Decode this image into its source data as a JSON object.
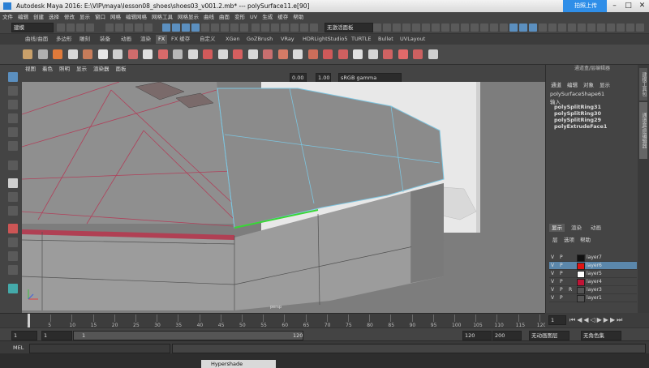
{
  "window": {
    "title": "Autodesk Maya 2016: E:\\VIP\\maya\\lesson08_shoes\\shoes03_v001.2.mb*  ---  polySurface11.e[90]",
    "upload_label": "拍照上传",
    "min": "–",
    "max": "□",
    "close": "✕"
  },
  "menus": [
    "文件",
    "编辑",
    "创建",
    "选择",
    "修改",
    "显示",
    "窗口",
    "网格",
    "编辑网格",
    "网格工具",
    "网格显示",
    "曲线",
    "曲面",
    "变形",
    "UV",
    "生成",
    "缓存",
    "帮助"
  ],
  "statusline": {
    "mode": "建模",
    "input_field": "无激活面板"
  },
  "shelf_tabs": [
    "曲线/曲面",
    "多边形",
    "雕刻",
    "装备",
    "动画",
    "渲染",
    "FX",
    "FX 缓存",
    "自定义",
    "XGen",
    "GoZBrush",
    "VRay",
    "HDRLightStudio5",
    "TURTLE",
    "Bullet",
    "UVLayout"
  ],
  "shelf_active": "FX",
  "shelf_icon_colors": [
    "#c9a06a",
    "#b0b0b0",
    "#e07a3a",
    "#d8d8d8",
    "#c77c5a",
    "#e8e8e8",
    "#cfcfcf",
    "#d06c6c",
    "#e0e0e0",
    "#d86a6a",
    "#b7b7b7",
    "#d8d8d8",
    "#d25a5a",
    "#d9d9d9",
    "#d65f5f",
    "#d9d9d9",
    "#c86f6f",
    "#d47b66",
    "#d9d9d9",
    "#cc6e5a",
    "#cf5959",
    "#d06060",
    "#e0e0e0",
    "#d4d4d4",
    "#cf6262",
    "#e06a6a",
    "#cc6060",
    "#d0d0d0"
  ],
  "panel_menu": [
    "视图",
    "着色",
    "照明",
    "显示",
    "渲染器",
    "面板"
  ],
  "panel_toolbar": {
    "exposure": "0.00",
    "gamma": "1.00",
    "color_space": "sRGB gamma"
  },
  "viewport": {
    "camera_label": "persp"
  },
  "channel_box": {
    "header": "通道盒/层编辑器",
    "menu": [
      "通道",
      "编辑",
      "对象",
      "显示"
    ],
    "node": "polySurfaceShape61",
    "inputs_label": "输入",
    "history": [
      "polySplitRing31",
      "polySplitRing30",
      "polySplitRing29",
      "polyExtrudeFace1"
    ]
  },
  "side_tabs": [
    "建模工具包",
    "通道盒/层编辑器"
  ],
  "layer_editor": {
    "tabs": [
      "显示",
      "渲染",
      "动画"
    ],
    "menu": [
      "层",
      "选项",
      "帮助"
    ],
    "layers": [
      {
        "v": "V",
        "p": "P",
        "r": "",
        "color": "#111111",
        "name": "layer7",
        "selected": false
      },
      {
        "v": "V",
        "p": "P",
        "r": "",
        "color": "#e01414",
        "name": "layer6",
        "selected": true
      },
      {
        "v": "V",
        "p": "P",
        "r": "",
        "color": "#ffffff",
        "name": "layer5",
        "selected": false
      },
      {
        "v": "V",
        "p": "P",
        "r": "",
        "color": "#c01436",
        "name": "layer4",
        "selected": false
      },
      {
        "v": "V",
        "p": "P",
        "r": "R",
        "color": "#555555",
        "name": "layer3",
        "selected": false
      },
      {
        "v": "V",
        "p": "P",
        "r": "",
        "color": "#555555",
        "name": "layer1",
        "selected": false
      }
    ]
  },
  "timeline": {
    "ticks": [
      "1",
      "5",
      "10",
      "15",
      "20",
      "25",
      "30",
      "35",
      "40",
      "45",
      "50",
      "55",
      "60",
      "65",
      "70",
      "75",
      "80",
      "85",
      "90",
      "95",
      "100",
      "105",
      "110",
      "115",
      "120"
    ],
    "current_frame": "1"
  },
  "range": {
    "start": "1",
    "playback_start": "1",
    "slider_start": "1",
    "slider_end": "120",
    "playback_end": "120",
    "end": "200",
    "anim_layer": "无动画图层",
    "char_set": "无角色集"
  },
  "command_line": {
    "label": "MEL"
  },
  "taskbar": {
    "item": "Hypershade"
  }
}
